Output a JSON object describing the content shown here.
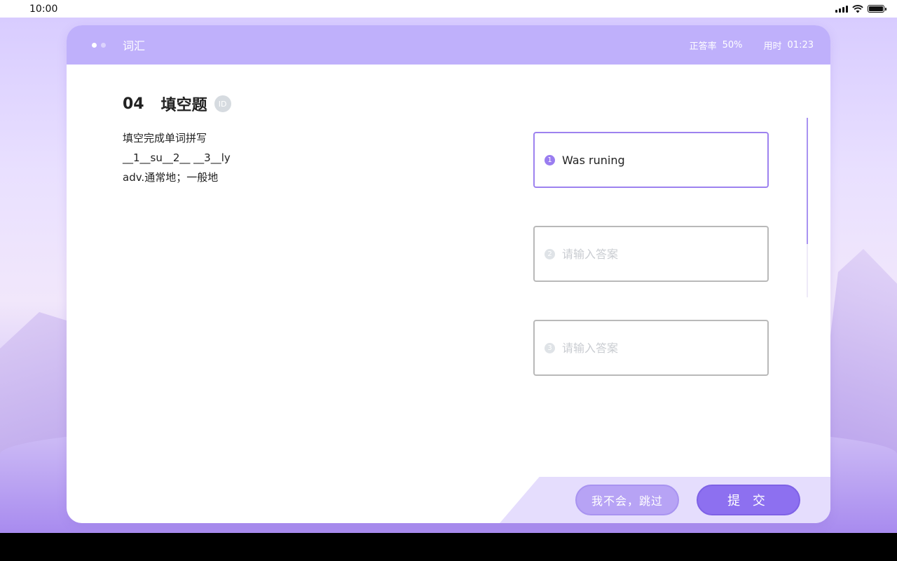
{
  "status_bar": {
    "time": "10:00"
  },
  "header": {
    "title": "词汇",
    "accuracy_label": "正答率",
    "accuracy_value": "50%",
    "time_label": "用时",
    "time_value": "01:23"
  },
  "question": {
    "number": "04",
    "type": "填空题",
    "id_badge": "ID",
    "instruction": "填空完成单词拼写",
    "pattern": "__1__su__2__ __3__ly",
    "definition": "adv.通常地；一般地"
  },
  "answers": [
    {
      "index": "1",
      "value": "Was runing",
      "placeholder": ""
    },
    {
      "index": "2",
      "value": "",
      "placeholder": "请输入答案"
    },
    {
      "index": "3",
      "value": "",
      "placeholder": "请输入答案"
    }
  ],
  "buttons": {
    "skip_label": "我不会，跳过",
    "submit_label": "提 交"
  },
  "colors": {
    "accent": "#8d70f0",
    "header_bg": "#bfb0fb",
    "active_border": "#9d82ef"
  }
}
